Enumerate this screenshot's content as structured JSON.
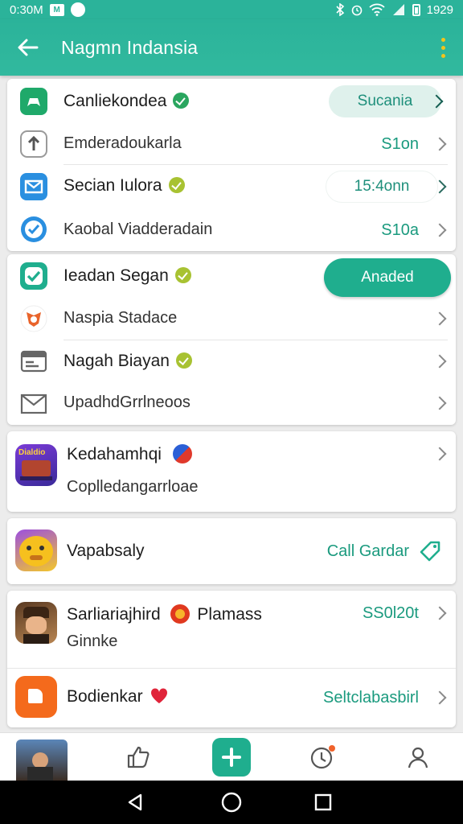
{
  "status_bar": {
    "time": "0:30M",
    "notif_badge": "M",
    "clock_right": "1929"
  },
  "app_bar": {
    "title": "Nagmn Indansia"
  },
  "card1": {
    "rows": [
      {
        "label": "Canliekondea",
        "action": "Sucania"
      },
      {
        "label": "Emderadoukarla",
        "value": "S1on"
      },
      {
        "label": "Secian Iulora",
        "action": "15:4onn"
      },
      {
        "label": "Kaobal Viadderadain",
        "value": "S10a"
      }
    ]
  },
  "card2": {
    "rows": [
      {
        "label": "Ieadan Segan",
        "action": "Anaded"
      },
      {
        "label": "Naspia Stadace"
      },
      {
        "label": "Nagah Biayan"
      },
      {
        "label": "UpadhdGrrlneoos"
      }
    ]
  },
  "card3": {
    "title": "Kedahamhqi",
    "subtitle": "Coplledangarrloae",
    "icon_text": "Dialdio"
  },
  "card4": {
    "title": "Vapabsaly",
    "action": "Call Gardar"
  },
  "card5": {
    "rows": [
      {
        "title": "Sarliariajhird",
        "tag": "Plamass",
        "value": "SS0l20t",
        "subtitle": "Ginnke"
      },
      {
        "title": "Bodienkar",
        "value": "Seltclabasbirl"
      }
    ]
  },
  "colors": {
    "accent": "#2bb39a",
    "accent_dark": "#1fae8e",
    "link": "#1a9a7e"
  },
  "icons": [
    "back-arrow-icon",
    "overflow-menu-icon",
    "gamepad-icon",
    "upload-icon",
    "mail-icon",
    "check-circle-icon",
    "badge-check-icon",
    "fox-icon",
    "id-card-icon",
    "envelope-icon",
    "tag-icon",
    "thumbs-up-icon",
    "plus-icon",
    "clock-icon",
    "profile-icon"
  ]
}
